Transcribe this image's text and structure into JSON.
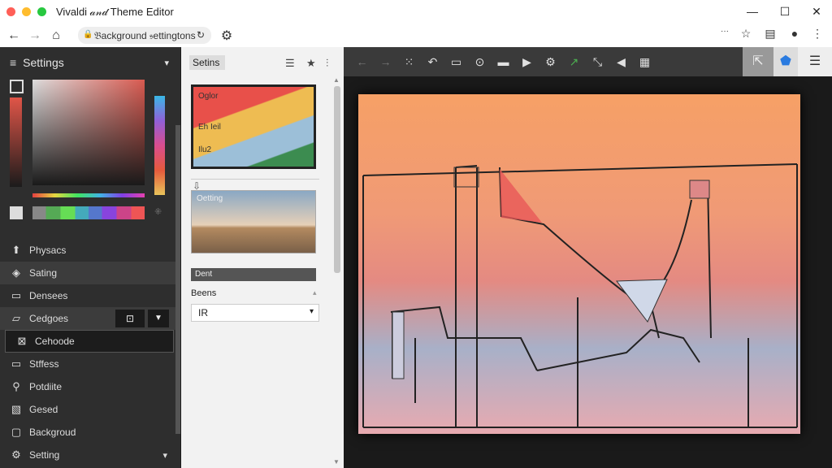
{
  "window": {
    "title": "Vivaldi 𝒶𝓃𝒹 Theme Editor"
  },
  "addressbar": {
    "url": "𝔅ackground 𝔰ettingtons"
  },
  "sidebar": {
    "title": "Settings",
    "items": [
      {
        "label": "Physacs",
        "icon": "arrow-up-icon"
      },
      {
        "label": "Sating",
        "icon": "shield-icon"
      },
      {
        "label": "Densees",
        "icon": "monitor-icon"
      },
      {
        "label": "Cedgoes",
        "icon": "folder-icon"
      },
      {
        "label": "Cehoode",
        "icon": "grid-icon"
      },
      {
        "label": "Stffess",
        "icon": "display-icon"
      },
      {
        "label": "Potdiite",
        "icon": "paint-icon"
      },
      {
        "label": "Gesed",
        "icon": "image-icon"
      },
      {
        "label": "Backgroud",
        "icon": "frame-icon"
      },
      {
        "label": "Setting",
        "icon": "gear-icon"
      }
    ]
  },
  "panel": {
    "title": "Setins",
    "color_card": {
      "lines": [
        "Oglor",
        "Eh Ieil",
        "Ilu2"
      ]
    },
    "image_card": {
      "label": "Oetting"
    },
    "select_value": "Dent",
    "field_label": "Beens",
    "field_value": "IR"
  },
  "colors": {
    "accent": "#4caf50",
    "brand": "#e8504a"
  }
}
